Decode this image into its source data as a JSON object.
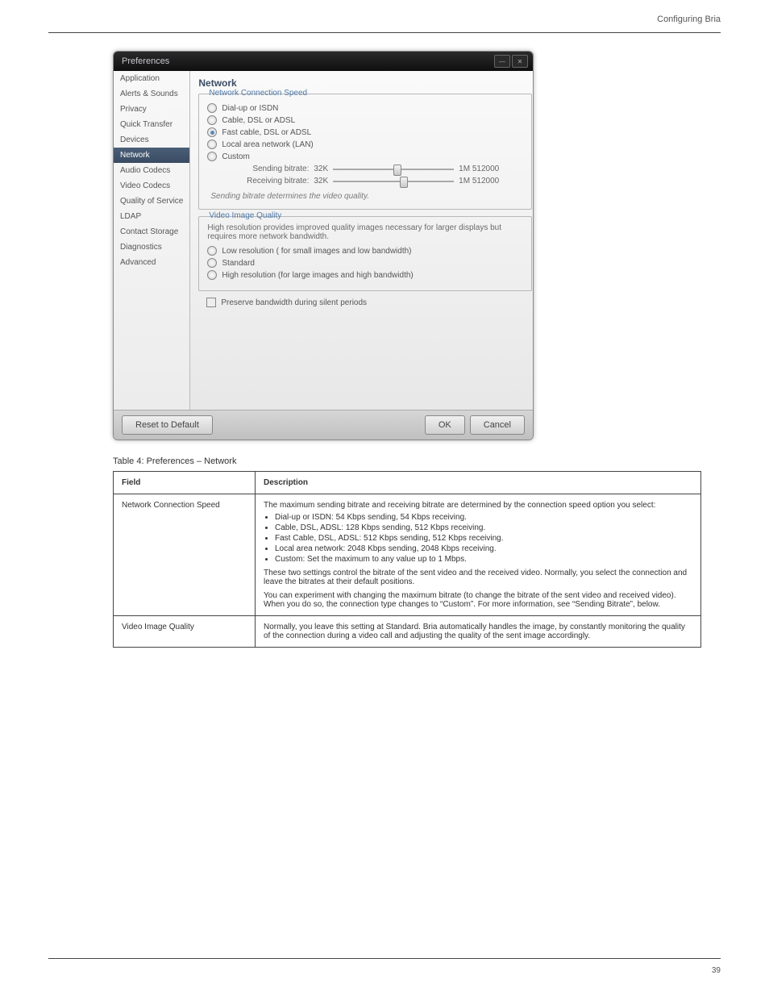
{
  "page": {
    "header_right": "Configuring Bria",
    "figure_caption": "",
    "body_text": "Table 4: Preferences – Network",
    "footer_left": "",
    "footer_right": "39"
  },
  "dialog": {
    "title": "Preferences",
    "sidebar": {
      "items": [
        {
          "label": "Application",
          "selected": false
        },
        {
          "label": "Alerts & Sounds",
          "selected": false
        },
        {
          "label": "Privacy",
          "selected": false
        },
        {
          "label": "Quick Transfer",
          "selected": false
        },
        {
          "label": "Devices",
          "selected": false
        },
        {
          "label": "Network",
          "selected": true
        },
        {
          "label": "Audio Codecs",
          "selected": false
        },
        {
          "label": "Video Codecs",
          "selected": false
        },
        {
          "label": "Quality of Service",
          "selected": false
        },
        {
          "label": "LDAP",
          "selected": false
        },
        {
          "label": "Contact Storage",
          "selected": false
        },
        {
          "label": "Diagnostics",
          "selected": false
        },
        {
          "label": "Advanced",
          "selected": false
        }
      ]
    },
    "content": {
      "title": "Network",
      "conn": {
        "legend": "Network Connection Speed",
        "options": [
          {
            "label": "Dial-up or ISDN",
            "checked": false
          },
          {
            "label": "Cable, DSL or ADSL",
            "checked": false
          },
          {
            "label": "Fast cable, DSL or ADSL",
            "checked": true
          },
          {
            "label": "Local area network (LAN)",
            "checked": false
          },
          {
            "label": "Custom",
            "checked": false
          }
        ],
        "sliders": [
          {
            "label": "Sending bitrate:",
            "min": "32K",
            "max": "1M",
            "value": "512000",
            "pos": 50
          },
          {
            "label": "Receiving bitrate:",
            "min": "32K",
            "max": "1M",
            "value": "512000",
            "pos": 55
          }
        ],
        "hint": "Sending bitrate determines the video quality."
      },
      "viq": {
        "legend": "Video Image Quality",
        "intro": "High resolution provides improved quality images necessary for larger displays but requires more network bandwidth.",
        "options": [
          {
            "label": "Low resolution ( for small images and low bandwidth)",
            "checked": false
          },
          {
            "label": "Standard",
            "checked": false
          },
          {
            "label": "High resolution (for large images and high bandwidth)",
            "checked": false
          }
        ]
      },
      "preserve": "Preserve bandwidth during silent periods"
    },
    "footer": {
      "reset": "Reset to Default",
      "ok": "OK",
      "cancel": "Cancel"
    }
  },
  "table": {
    "header": {
      "c1": "Field",
      "c2": "Description"
    },
    "rows": [
      {
        "c1": "Network Connection Speed",
        "c2_intro": "The maximum sending bitrate and receiving bitrate are determined by the connection speed option you select:",
        "c2_bullets": [
          "Dial-up or ISDN: 54 Kbps sending, 54 Kbps receiving.",
          "Cable, DSL, ADSL: 128 Kbps sending, 512 Kbps receiving.",
          "Fast Cable, DSL, ADSL: 512 Kbps sending, 512 Kbps receiving.",
          "Local area network: 2048 Kbps sending, 2048 Kbps receiving.",
          "Custom: Set the maximum to any value up to 1 Mbps."
        ],
        "c2_p1": "These two settings control the bitrate of the sent video and the received video. Normally, you select the connection and leave the bitrates at their default positions.",
        "c2_p2": "You can experiment with changing the maximum bitrate (to change the bitrate of the sent video and received video). When you do so, the connection type changes to “Custom”. For more information, see “Sending Bitrate”, below."
      },
      {
        "c1": "Video Image Quality",
        "c2_intro": "Normally, you leave this setting at Standard. Bria automatically handles the image, by constantly monitoring the quality of the connection during a video call and adjusting the quality of the sent image accordingly."
      }
    ]
  }
}
